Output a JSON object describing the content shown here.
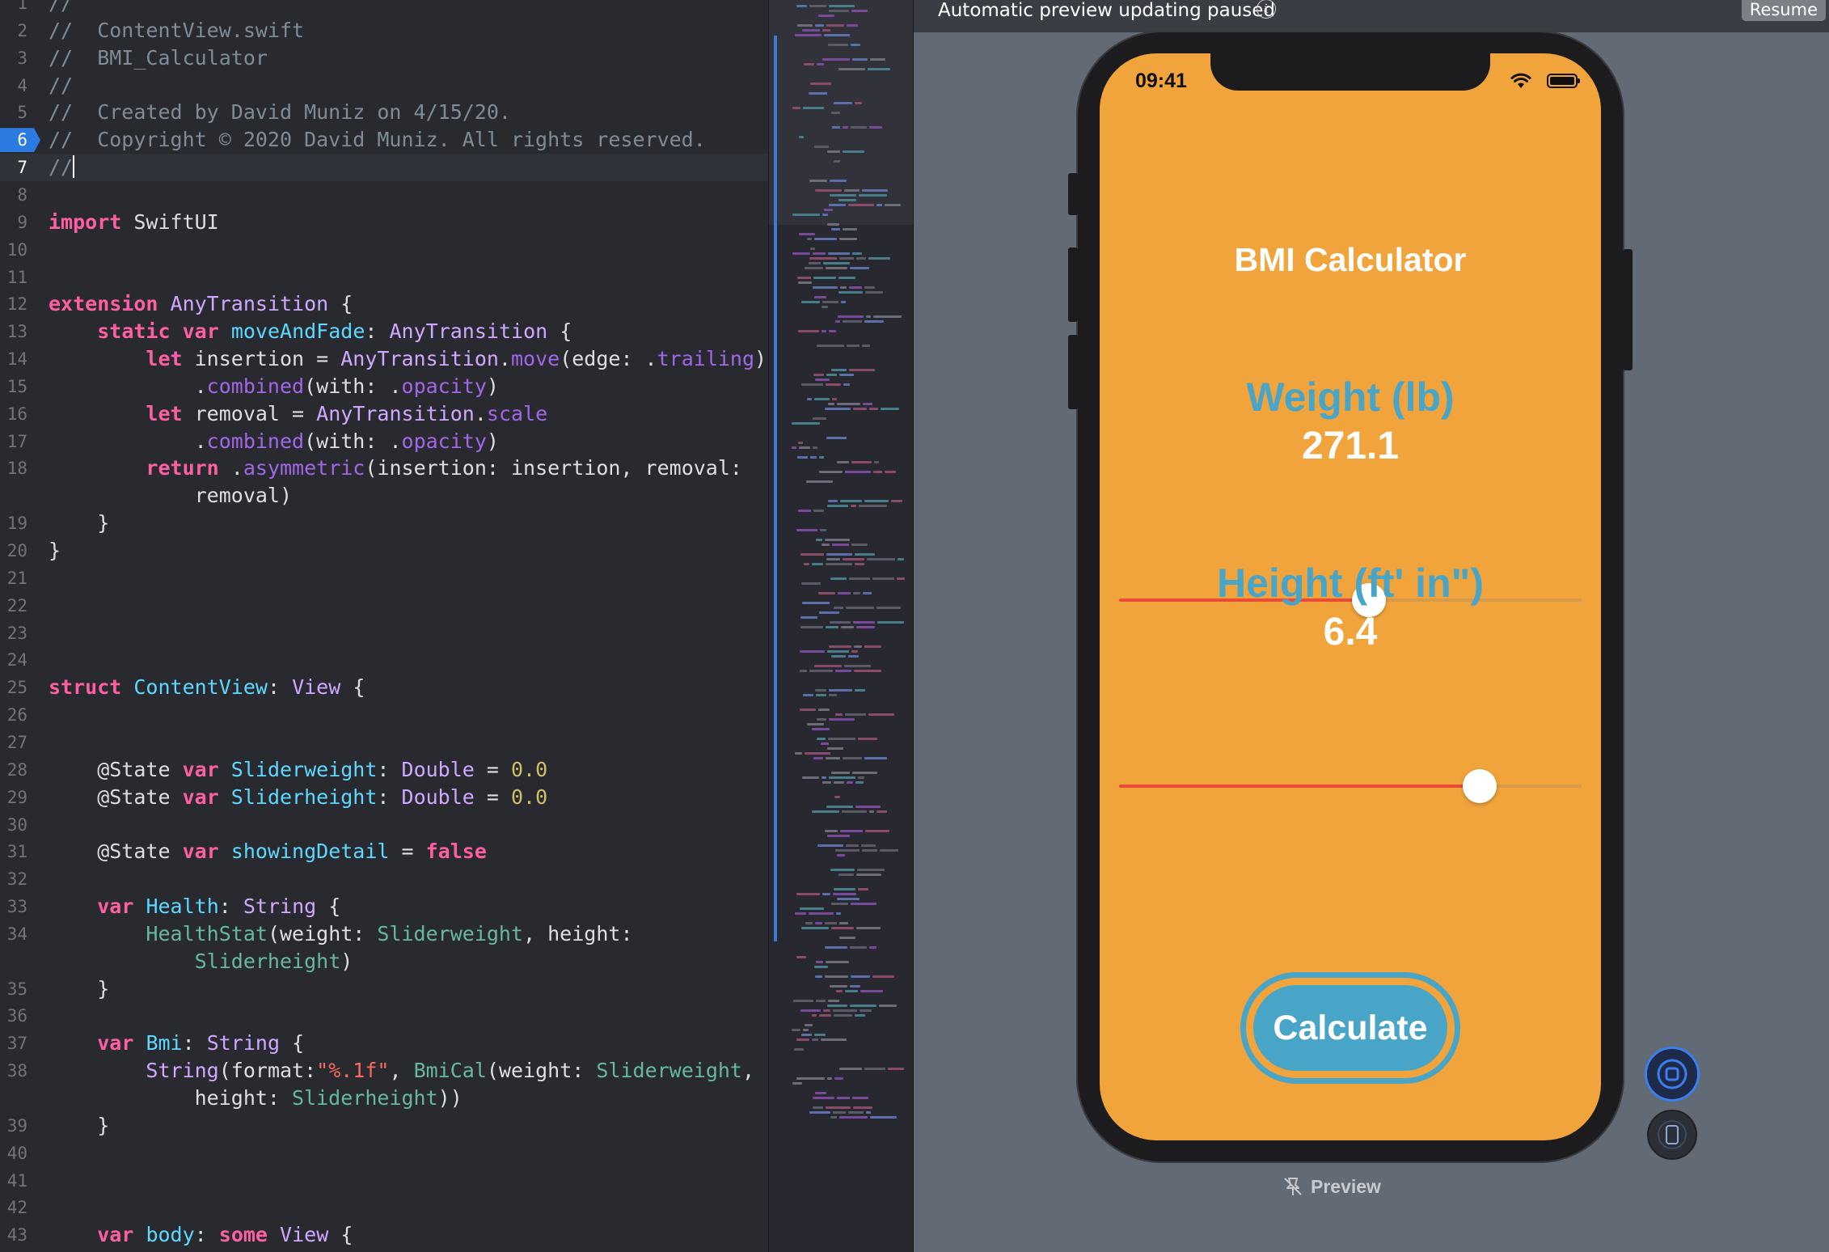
{
  "editor": {
    "current_line": 7,
    "lines": [
      {
        "n": "1",
        "segs": [
          {
            "c": "t-comment",
            "t": "//"
          }
        ]
      },
      {
        "n": "2",
        "segs": [
          {
            "c": "t-comment",
            "t": "//  ContentView.swift"
          }
        ]
      },
      {
        "n": "3",
        "segs": [
          {
            "c": "t-comment",
            "t": "//  BMI_Calculator"
          }
        ]
      },
      {
        "n": "4",
        "segs": [
          {
            "c": "t-comment",
            "t": "//"
          }
        ]
      },
      {
        "n": "5",
        "segs": [
          {
            "c": "t-comment",
            "t": "//  Created by David Muniz on 4/15/20."
          }
        ]
      },
      {
        "n": "6",
        "marker": true,
        "segs": [
          {
            "c": "t-comment",
            "t": "//  Copyright © 2020 David Muniz. All rights reserved."
          }
        ]
      },
      {
        "n": "7",
        "current": true,
        "segs": [
          {
            "c": "t-comment",
            "t": "//"
          }
        ],
        "caret": true
      },
      {
        "n": "8",
        "segs": []
      },
      {
        "n": "9",
        "segs": [
          {
            "c": "t-kw",
            "t": "import"
          },
          {
            "c": "t-plain",
            "t": " SwiftUI"
          }
        ]
      },
      {
        "n": "10",
        "segs": []
      },
      {
        "n": "11",
        "segs": []
      },
      {
        "n": "12",
        "segs": [
          {
            "c": "t-kw",
            "t": "extension"
          },
          {
            "c": "t-plain",
            "t": " "
          },
          {
            "c": "t-type",
            "t": "AnyTransition"
          },
          {
            "c": "t-plain",
            "t": " {"
          }
        ]
      },
      {
        "n": "13",
        "segs": [
          {
            "c": "t-plain",
            "t": "    "
          },
          {
            "c": "t-kw",
            "t": "static"
          },
          {
            "c": "t-plain",
            "t": " "
          },
          {
            "c": "t-kw",
            "t": "var"
          },
          {
            "c": "t-plain",
            "t": " "
          },
          {
            "c": "t-ltype",
            "t": "moveAndFade"
          },
          {
            "c": "t-plain",
            "t": ": "
          },
          {
            "c": "t-type",
            "t": "AnyTransition"
          },
          {
            "c": "t-plain",
            "t": " {"
          }
        ]
      },
      {
        "n": "14",
        "segs": [
          {
            "c": "t-plain",
            "t": "        "
          },
          {
            "c": "t-kw",
            "t": "let"
          },
          {
            "c": "t-plain",
            "t": " insertion = "
          },
          {
            "c": "t-type",
            "t": "AnyTransition"
          },
          {
            "c": "t-plain",
            "t": "."
          },
          {
            "c": "t-method",
            "t": "move"
          },
          {
            "c": "t-plain",
            "t": "(edge: ."
          },
          {
            "c": "t-method",
            "t": "trailing"
          },
          {
            "c": "t-plain",
            "t": ")"
          }
        ]
      },
      {
        "n": "15",
        "segs": [
          {
            "c": "t-plain",
            "t": "            ."
          },
          {
            "c": "t-method",
            "t": "combined"
          },
          {
            "c": "t-plain",
            "t": "(with: ."
          },
          {
            "c": "t-method",
            "t": "opacity"
          },
          {
            "c": "t-plain",
            "t": ")"
          }
        ]
      },
      {
        "n": "16",
        "segs": [
          {
            "c": "t-plain",
            "t": "        "
          },
          {
            "c": "t-kw",
            "t": "let"
          },
          {
            "c": "t-plain",
            "t": " removal = "
          },
          {
            "c": "t-type",
            "t": "AnyTransition"
          },
          {
            "c": "t-plain",
            "t": "."
          },
          {
            "c": "t-method",
            "t": "scale"
          }
        ]
      },
      {
        "n": "17",
        "segs": [
          {
            "c": "t-plain",
            "t": "            ."
          },
          {
            "c": "t-method",
            "t": "combined"
          },
          {
            "c": "t-plain",
            "t": "(with: ."
          },
          {
            "c": "t-method",
            "t": "opacity"
          },
          {
            "c": "t-plain",
            "t": ")"
          }
        ]
      },
      {
        "n": "18",
        "segs": [
          {
            "c": "t-plain",
            "t": "        "
          },
          {
            "c": "t-kw",
            "t": "return"
          },
          {
            "c": "t-plain",
            "t": " ."
          },
          {
            "c": "t-method",
            "t": "asymmetric"
          },
          {
            "c": "t-plain",
            "t": "(insertion: insertion, removal:"
          }
        ]
      },
      {
        "n": "",
        "segs": [
          {
            "c": "t-plain",
            "t": "            removal)"
          }
        ]
      },
      {
        "n": "19",
        "segs": [
          {
            "c": "t-plain",
            "t": "    }"
          }
        ]
      },
      {
        "n": "20",
        "segs": [
          {
            "c": "t-plain",
            "t": "}"
          }
        ]
      },
      {
        "n": "21",
        "segs": []
      },
      {
        "n": "22",
        "segs": []
      },
      {
        "n": "23",
        "segs": []
      },
      {
        "n": "24",
        "segs": []
      },
      {
        "n": "25",
        "segs": [
          {
            "c": "t-kw",
            "t": "struct"
          },
          {
            "c": "t-plain",
            "t": " "
          },
          {
            "c": "t-ltype",
            "t": "ContentView"
          },
          {
            "c": "t-plain",
            "t": ": "
          },
          {
            "c": "t-type",
            "t": "View"
          },
          {
            "c": "t-plain",
            "t": " {"
          }
        ]
      },
      {
        "n": "26",
        "segs": []
      },
      {
        "n": "27",
        "segs": []
      },
      {
        "n": "28",
        "segs": [
          {
            "c": "t-plain",
            "t": "    @State "
          },
          {
            "c": "t-kw",
            "t": "var"
          },
          {
            "c": "t-plain",
            "t": " "
          },
          {
            "c": "t-ltype",
            "t": "Sliderweight"
          },
          {
            "c": "t-plain",
            "t": ": "
          },
          {
            "c": "t-type",
            "t": "Double"
          },
          {
            "c": "t-plain",
            "t": " = "
          },
          {
            "c": "t-num",
            "t": "0.0"
          }
        ]
      },
      {
        "n": "29",
        "segs": [
          {
            "c": "t-plain",
            "t": "    @State "
          },
          {
            "c": "t-kw",
            "t": "var"
          },
          {
            "c": "t-plain",
            "t": " "
          },
          {
            "c": "t-ltype",
            "t": "Sliderheight"
          },
          {
            "c": "t-plain",
            "t": ": "
          },
          {
            "c": "t-type",
            "t": "Double"
          },
          {
            "c": "t-plain",
            "t": " = "
          },
          {
            "c": "t-num",
            "t": "0.0"
          }
        ]
      },
      {
        "n": "30",
        "segs": []
      },
      {
        "n": "31",
        "segs": [
          {
            "c": "t-plain",
            "t": "    @State "
          },
          {
            "c": "t-kw",
            "t": "var"
          },
          {
            "c": "t-plain",
            "t": " "
          },
          {
            "c": "t-ltype",
            "t": "showingDetail"
          },
          {
            "c": "t-plain",
            "t": " = "
          },
          {
            "c": "t-kw",
            "t": "false"
          }
        ]
      },
      {
        "n": "32",
        "segs": []
      },
      {
        "n": "33",
        "segs": [
          {
            "c": "t-plain",
            "t": "    "
          },
          {
            "c": "t-kw",
            "t": "var"
          },
          {
            "c": "t-plain",
            "t": " "
          },
          {
            "c": "t-ltype",
            "t": "Health"
          },
          {
            "c": "t-plain",
            "t": ": "
          },
          {
            "c": "t-type",
            "t": "String"
          },
          {
            "c": "t-plain",
            "t": " {"
          }
        ]
      },
      {
        "n": "34",
        "segs": [
          {
            "c": "t-plain",
            "t": "        "
          },
          {
            "c": "t-prop",
            "t": "HealthStat"
          },
          {
            "c": "t-plain",
            "t": "(weight: "
          },
          {
            "c": "t-prop",
            "t": "Sliderweight"
          },
          {
            "c": "t-plain",
            "t": ", height:"
          }
        ]
      },
      {
        "n": "",
        "segs": [
          {
            "c": "t-plain",
            "t": "            "
          },
          {
            "c": "t-prop",
            "t": "Sliderheight"
          },
          {
            "c": "t-plain",
            "t": ")"
          }
        ]
      },
      {
        "n": "35",
        "segs": [
          {
            "c": "t-plain",
            "t": "    }"
          }
        ]
      },
      {
        "n": "36",
        "segs": []
      },
      {
        "n": "37",
        "segs": [
          {
            "c": "t-plain",
            "t": "    "
          },
          {
            "c": "t-kw",
            "t": "var"
          },
          {
            "c": "t-plain",
            "t": " "
          },
          {
            "c": "t-ltype",
            "t": "Bmi"
          },
          {
            "c": "t-plain",
            "t": ": "
          },
          {
            "c": "t-type",
            "t": "String"
          },
          {
            "c": "t-plain",
            "t": " {"
          }
        ]
      },
      {
        "n": "38",
        "segs": [
          {
            "c": "t-plain",
            "t": "        "
          },
          {
            "c": "t-type",
            "t": "String"
          },
          {
            "c": "t-plain",
            "t": "(format:"
          },
          {
            "c": "t-str",
            "t": "\"%.1f\""
          },
          {
            "c": "t-plain",
            "t": ", "
          },
          {
            "c": "t-prop",
            "t": "BmiCal"
          },
          {
            "c": "t-plain",
            "t": "(weight: "
          },
          {
            "c": "t-prop",
            "t": "Sliderweight"
          },
          {
            "c": "t-plain",
            "t": ","
          }
        ]
      },
      {
        "n": "",
        "segs": [
          {
            "c": "t-plain",
            "t": "            height: "
          },
          {
            "c": "t-prop",
            "t": "Sliderheight"
          },
          {
            "c": "t-plain",
            "t": "))"
          }
        ]
      },
      {
        "n": "39",
        "segs": [
          {
            "c": "t-plain",
            "t": "    }"
          }
        ]
      },
      {
        "n": "40",
        "segs": []
      },
      {
        "n": "41",
        "segs": []
      },
      {
        "n": "42",
        "segs": []
      },
      {
        "n": "43",
        "segs": [
          {
            "c": "t-plain",
            "t": "    "
          },
          {
            "c": "t-kw",
            "t": "var"
          },
          {
            "c": "t-plain",
            "t": " "
          },
          {
            "c": "t-ltype",
            "t": "body"
          },
          {
            "c": "t-plain",
            "t": ": "
          },
          {
            "c": "t-kw",
            "t": "some"
          },
          {
            "c": "t-plain",
            "t": " "
          },
          {
            "c": "t-type",
            "t": "View"
          },
          {
            "c": "t-plain",
            "t": " {"
          }
        ]
      }
    ]
  },
  "colors": {
    "accent": "#2b7be0",
    "phone_background": "#f1a43c",
    "label_blue": "#49a5c7",
    "slider_fill": "#ea4a36"
  },
  "canvas": {
    "status_text": "Automatic preview updating paused",
    "info_icon": "info-circle-icon",
    "resume_label": "Resume",
    "footer_label": "Preview",
    "footer_icon": "pin-slash-icon",
    "live_icon": "live-preview-icon",
    "device_icon": "device-settings-icon"
  },
  "phone": {
    "time": "09:41",
    "title": "BMI Calculator",
    "weight_label": "Weight (lb)",
    "weight_value": "271.1",
    "weight_slider_fraction": 0.54,
    "height_label": "Height (ft' in\")",
    "height_value": "6.4",
    "height_slider_fraction": 0.78,
    "button_label": "Calculate"
  }
}
